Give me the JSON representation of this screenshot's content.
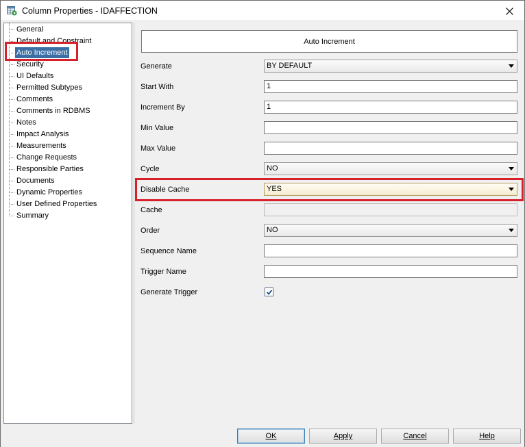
{
  "window": {
    "title": "Column Properties - IDAFFECTION",
    "icon": "table-properties-icon",
    "close_icon": "close-icon"
  },
  "nav": {
    "items": [
      {
        "label": "General"
      },
      {
        "label": "Default and Constraint"
      },
      {
        "label": "Auto Increment",
        "selected": true
      },
      {
        "label": "Security"
      },
      {
        "label": "UI Defaults"
      },
      {
        "label": "Permitted Subtypes"
      },
      {
        "label": "Comments"
      },
      {
        "label": "Comments in RDBMS"
      },
      {
        "label": "Notes"
      },
      {
        "label": "Impact Analysis"
      },
      {
        "label": "Measurements"
      },
      {
        "label": "Change Requests"
      },
      {
        "label": "Responsible Parties"
      },
      {
        "label": "Documents"
      },
      {
        "label": "Dynamic Properties"
      },
      {
        "label": "User Defined Properties"
      },
      {
        "label": "Summary"
      }
    ]
  },
  "panel": {
    "header": "Auto Increment",
    "fields": {
      "generate": {
        "label": "Generate",
        "value": "BY DEFAULT"
      },
      "start_with": {
        "label": "Start With",
        "value": "1"
      },
      "increment_by": {
        "label": "Increment By",
        "value": "1"
      },
      "min_value": {
        "label": "Min Value",
        "value": ""
      },
      "max_value": {
        "label": "Max Value",
        "value": ""
      },
      "cycle": {
        "label": "Cycle",
        "value": "NO"
      },
      "disable_cache": {
        "label": "Disable Cache",
        "value": "YES"
      },
      "cache": {
        "label": "Cache",
        "value": ""
      },
      "order": {
        "label": "Order",
        "value": "NO"
      },
      "sequence_name": {
        "label": "Sequence Name",
        "value": ""
      },
      "trigger_name": {
        "label": "Trigger Name",
        "value": ""
      },
      "generate_trigger": {
        "label": "Generate Trigger",
        "checked": true
      }
    }
  },
  "buttons": {
    "ok": "OK",
    "apply": "Apply",
    "cancel": "Cancel",
    "help": "Help"
  },
  "colors": {
    "highlight": "#d6202a",
    "selection": "#3b6ea5"
  }
}
